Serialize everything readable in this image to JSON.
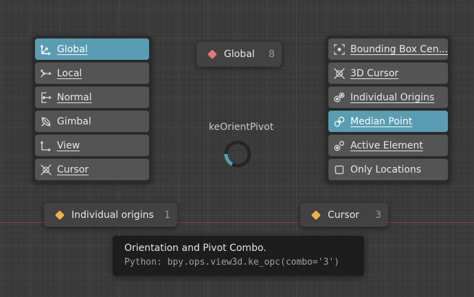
{
  "colors": {
    "accent": "#5a9cb2",
    "global_diamond": "#e47878",
    "orange_diamond": "#f0b441",
    "axis_red": "#a8384a"
  },
  "orientation_menu": {
    "items": [
      {
        "label": "Global",
        "icon": "global-orientation-icon",
        "active": true
      },
      {
        "label": "Local",
        "icon": "local-orientation-icon",
        "active": false
      },
      {
        "label": "Normal",
        "icon": "normal-orientation-icon",
        "active": false
      },
      {
        "label": "Gimbal",
        "icon": "gimbal-orientation-icon",
        "active": false
      },
      {
        "label": "View",
        "icon": "view-orientation-icon",
        "active": false
      },
      {
        "label": "Cursor",
        "icon": "cursor-orientation-icon",
        "active": false
      }
    ]
  },
  "pivot_menu": {
    "items": [
      {
        "label": "Bounding Box Cen...",
        "icon": "bounding-box-center-icon",
        "active": false
      },
      {
        "label": "3D Cursor",
        "icon": "3d-cursor-icon",
        "active": false
      },
      {
        "label": "Individual Origins",
        "icon": "individual-origins-icon",
        "active": false
      },
      {
        "label": "Median Point",
        "icon": "median-point-icon",
        "active": true
      },
      {
        "label": "Active Element",
        "icon": "active-element-icon",
        "active": false
      },
      {
        "label": "Only Locations",
        "icon": "checkbox-icon",
        "active": false
      }
    ]
  },
  "combo_top": {
    "label": "Global",
    "number": "8"
  },
  "combo_left": {
    "label": "Individual origins",
    "number": "1"
  },
  "combo_right": {
    "label": "Cursor",
    "number": "3"
  },
  "operator_title": "keOrientPivot",
  "tooltip": {
    "title": "Orientation and Pivot Combo.",
    "python": "Python: bpy.ops.view3d.ke_opc(combo='3')"
  }
}
